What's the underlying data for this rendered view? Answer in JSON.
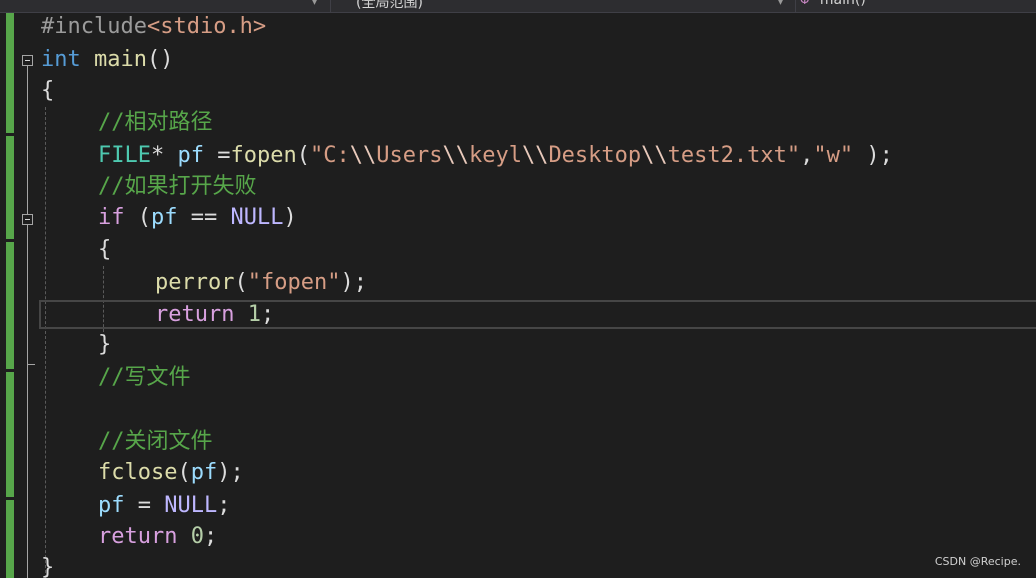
{
  "navbar": {
    "scope_label": "(全局范围)",
    "function_label": "main()"
  },
  "code": {
    "l1_a": "#include",
    "l1_b": "<stdio.h>",
    "l2_kw": "int",
    "l2_fn": "main",
    "l2_rest": "()",
    "l3": "{",
    "l4_comment": "//相对路径",
    "l5_type": "FILE",
    "l5_star": "* ",
    "l5_var": "pf",
    "l5_eq": " =",
    "l5_fn": "fopen",
    "l5_open": "(",
    "l5_str_a": "\"C:",
    "l5_esc1": "\\\\",
    "l5_str_b": "Users",
    "l5_esc2": "\\\\",
    "l5_str_c": "keyl",
    "l5_esc3": "\\\\",
    "l5_str_d": "Desktop",
    "l5_esc4": "\\\\",
    "l5_str_e": "test2.txt\"",
    "l5_comma": ",",
    "l5_str_f": "\"w\"",
    "l5_close": " );",
    "l6_comment": "//如果打开失败",
    "l7_kw": "if",
    "l7_a": " (",
    "l7_var": "pf",
    "l7_b": " == ",
    "l7_null": "NULL",
    "l7_c": ")",
    "l8": "{",
    "l9_fn": "perror",
    "l9_a": "(",
    "l9_str": "\"fopen\"",
    "l9_b": ");",
    "l10_kw": "return",
    "l10_sp": " ",
    "l10_num": "1",
    "l10_end": ";",
    "l11": "}",
    "l12_comment": "//写文件",
    "l14_comment": "//关闭文件",
    "l15_fn": "fclose",
    "l15_a": "(",
    "l15_var": "pf",
    "l15_b": ");",
    "l16_var": "pf",
    "l16_a": " = ",
    "l16_null": "NULL",
    "l16_b": ";",
    "l17_kw": "return",
    "l17_sp": " ",
    "l17_num": "0",
    "l17_end": ";",
    "l18": "}"
  },
  "watermark": "CSDN @Recipe.",
  "colors": {
    "background": "#1e1e1e",
    "keyword": "#569cd6",
    "control_keyword": "#d8a0df",
    "function": "#dcdcaa",
    "string": "#d69d85",
    "comment": "#57a64a",
    "variable": "#9cdcfe",
    "type": "#4ec9b0",
    "number": "#b5cea8"
  }
}
